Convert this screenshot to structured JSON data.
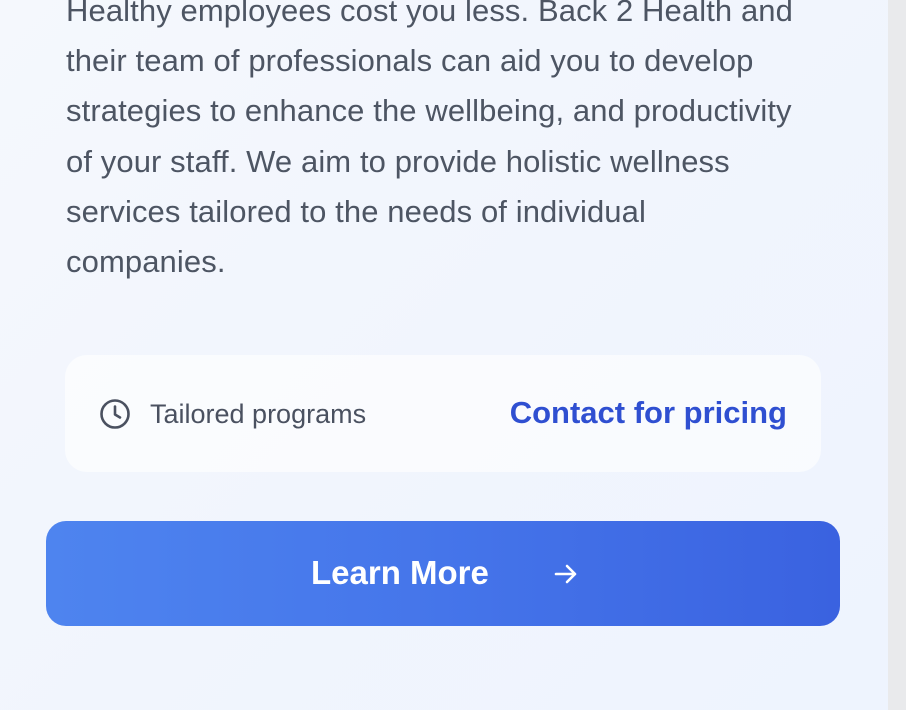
{
  "description": "Healthy employees cost you less. Back 2 Health and their team of professionals can aid you to develop strategies to enhance the wellbeing, and productivity of your staff. We aim to provide holistic wellness services tailored to the needs of individual companies.",
  "info": {
    "icon": "clock-icon",
    "label": "Tailored programs",
    "pricing": "Contact for pricing"
  },
  "cta": {
    "label": "Learn More",
    "icon": "arrow-right-icon"
  },
  "colors": {
    "accent_text": "#2f4fd1",
    "button_start": "#4e84ef",
    "button_end": "#3a62e0",
    "body_text": "#4d5563"
  }
}
